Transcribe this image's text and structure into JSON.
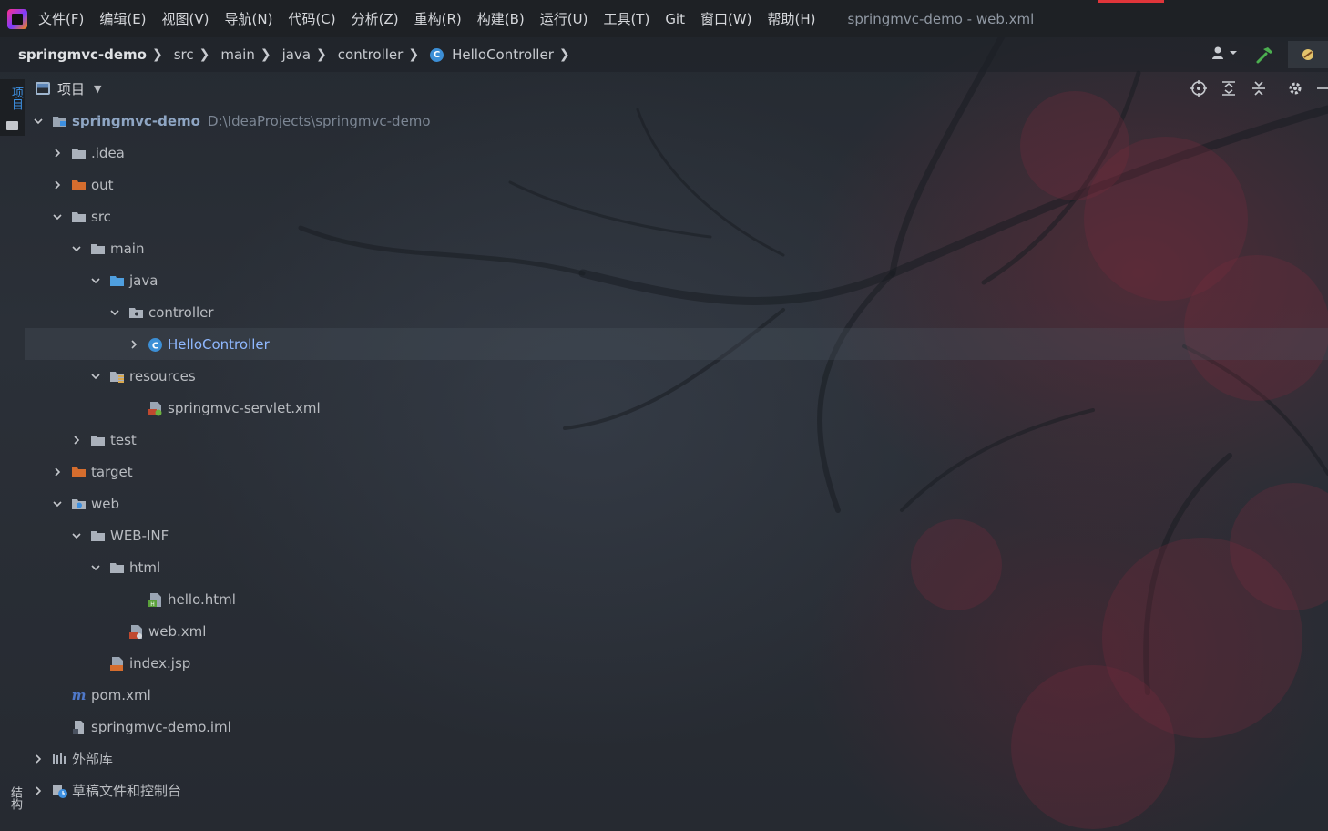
{
  "menubar": {
    "items": [
      "文件(F)",
      "编辑(E)",
      "视图(V)",
      "导航(N)",
      "代码(C)",
      "分析(Z)",
      "重构(R)",
      "构建(B)",
      "运行(U)",
      "工具(T)",
      "Git",
      "窗口(W)",
      "帮助(H)"
    ],
    "window_title": "springmvc-demo - web.xml"
  },
  "breadcrumb": {
    "items": [
      "springmvc-demo",
      "src",
      "main",
      "java",
      "controller",
      "HelloController"
    ],
    "class_icon_letter": "C"
  },
  "left_strip": {
    "project_tab": "项目",
    "structure_tab": "结构"
  },
  "panel": {
    "title": "项目"
  },
  "colors": {
    "accent_blue": "#3d8fe0",
    "folder_orange": "#d56d2e",
    "folder_gray": "#c4c7cc",
    "source_blue": "#4f9fdf"
  },
  "tree": {
    "root": {
      "label": "springmvc-demo",
      "path": "D:\\IdeaProjects\\springmvc-demo"
    },
    "idea": ".idea",
    "out": "out",
    "src": "src",
    "main": "main",
    "java": "java",
    "controller": "controller",
    "hello_controller": "HelloController",
    "resources": "resources",
    "servlet_xml": "springmvc-servlet.xml",
    "test": "test",
    "target": "target",
    "web": "web",
    "web_inf": "WEB-INF",
    "html": "html",
    "hello_html": "hello.html",
    "web_xml": "web.xml",
    "index_jsp": "index.jsp",
    "pom_xml": "pom.xml",
    "iml": "springmvc-demo.iml",
    "external_libs": "外部库",
    "scratches": "草稿文件和控制台"
  }
}
